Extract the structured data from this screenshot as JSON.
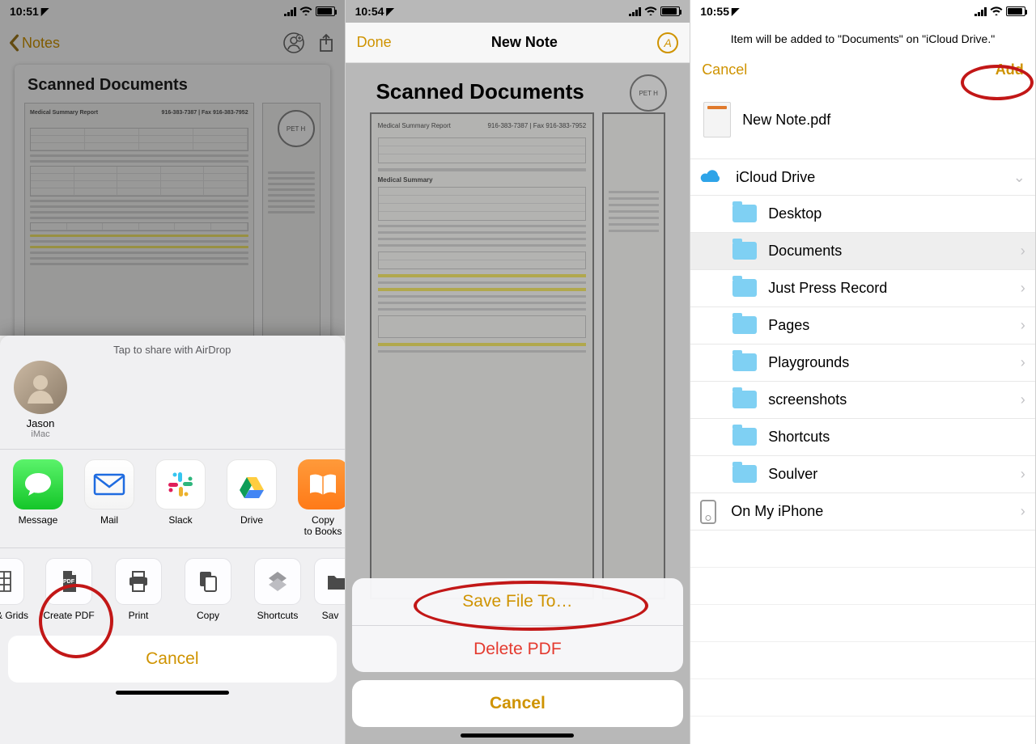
{
  "panel1": {
    "time": "10:51",
    "back_label": "Notes",
    "doc_title": "Scanned Documents",
    "airdrop_label": "Tap to share with AirDrop",
    "airdrop_contact": {
      "name": "Jason",
      "device": "iMac"
    },
    "share_apps": [
      {
        "id": "message",
        "label": "Message"
      },
      {
        "id": "mail",
        "label": "Mail"
      },
      {
        "id": "slack",
        "label": "Slack"
      },
      {
        "id": "drive",
        "label": "Drive"
      },
      {
        "id": "books",
        "label": "Copy\nto Books"
      }
    ],
    "actions": [
      {
        "id": "grids",
        "label": "& Grids"
      },
      {
        "id": "create-pdf",
        "label": "Create PDF"
      },
      {
        "id": "print",
        "label": "Print"
      },
      {
        "id": "copy",
        "label": "Copy"
      },
      {
        "id": "shortcuts",
        "label": "Shortcuts"
      },
      {
        "id": "save",
        "label": "Sav"
      }
    ],
    "cancel": "Cancel"
  },
  "panel2": {
    "time": "10:54",
    "done": "Done",
    "title": "New Note",
    "doc_title": "Scanned Documents",
    "save_file": "Save File To…",
    "delete_pdf": "Delete PDF",
    "cancel": "Cancel"
  },
  "panel3": {
    "time": "10:55",
    "message": "Item will be added to \"Documents\" on \"iCloud Drive.\"",
    "cancel": "Cancel",
    "add": "Add",
    "filename": "New Note.pdf",
    "locations": {
      "icloud": "iCloud Drive",
      "onmyiphone": "On My iPhone"
    },
    "folders": [
      "Desktop",
      "Documents",
      "Just Press Record",
      "Pages",
      "Playgrounds",
      "screenshots",
      "Shortcuts",
      "Soulver"
    ],
    "selected_folder_index": 1
  }
}
